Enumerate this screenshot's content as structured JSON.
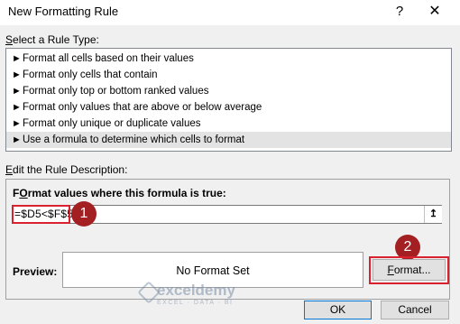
{
  "window": {
    "title": "New Formatting Rule",
    "help": "?",
    "close": "✕"
  },
  "rule_type": {
    "label_prefix": "",
    "label_underlined": "S",
    "label_rest": "elect a Rule Type:",
    "items": [
      "Format all cells based on their values",
      "Format only cells that contain",
      "Format only top or bottom ranked values",
      "Format only values that are above or below average",
      "Format only unique or duplicate values",
      "Use a formula to determine which cells to format"
    ],
    "selected_index": 5,
    "item_marker": "►"
  },
  "description": {
    "label_underlined": "E",
    "label_rest": "dit the Rule Description:",
    "formula_label_underlined": "O",
    "formula_label_pre": "F",
    "formula_label_rest": "rmat values where this formula is true:",
    "formula_value": "=$D5<$F$5",
    "collapse_icon": "↥",
    "preview_label": "Preview:",
    "preview_text": "No Format Set",
    "format_button": "Format...",
    "format_button_underlined": "F",
    "format_button_rest": "ormat..."
  },
  "badges": {
    "one": "1",
    "two": "2"
  },
  "buttons": {
    "ok": "OK",
    "cancel": "Cancel"
  },
  "watermark": {
    "name": "exceldemy",
    "sub": "EXCEL · DATA · BI"
  },
  "colors": {
    "highlight_box": "#d9212f",
    "badge": "#a31f21",
    "ok_border": "#0078d7"
  }
}
